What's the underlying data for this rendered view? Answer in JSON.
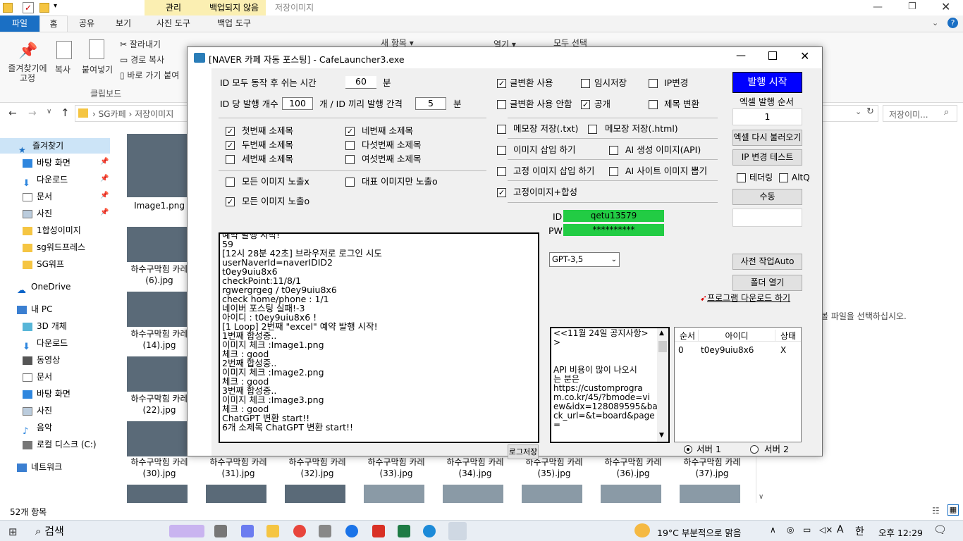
{
  "explorer": {
    "context_tabs": [
      "관리",
      "백업되지 않음",
      "저장이미지"
    ],
    "tabs": [
      "파일",
      "홈",
      "공유",
      "보기",
      "사진 도구",
      "백업 도구"
    ],
    "ribbon": {
      "pin_label": "즐겨찾기에\n고정",
      "copy_label": "복사",
      "paste_label": "붙여넣기",
      "cut_label": "잘라내기",
      "copy_path_label": "경로 복사",
      "paste_shortcut_label": "바로 가기 붙여",
      "clipboard_group": "클립보드",
      "new_item_label": "새 항목",
      "open_label": "열기",
      "select_all_label": "모두 선택"
    },
    "breadcrumb": [
      "SG카페",
      "저장이미지"
    ],
    "search_placeholder": "저장이미...",
    "nav_items": [
      "즐겨찾기",
      "바탕 화면",
      "다운로드",
      "문서",
      "사진",
      "1합성이미지",
      "sg워드프레스",
      "SG워프",
      "OneDrive",
      "내 PC",
      "3D 개체",
      "다운로드",
      "동영상",
      "문서",
      "바탕 화면",
      "사진",
      "음악",
      "로컬 디스크 (C:)",
      "네트워크"
    ],
    "files": [
      {
        "name": "Image1.png"
      },
      {
        "name": "하수구막힘 카레\n(6).jpg"
      },
      {
        "name": "하수구막힘 카레\n(14).jpg"
      },
      {
        "name": "하수구막힘 카레\n(22).jpg"
      },
      {
        "name": "하수구막힘 카레\n(30).jpg"
      },
      {
        "name": "하수구막힘 카레\n(31).jpg"
      },
      {
        "name": "하수구막힘 카레\n(32).jpg"
      },
      {
        "name": "하수구막힘 카레\n(33).jpg"
      },
      {
        "name": "하수구막힘 카레\n(34).jpg"
      },
      {
        "name": "하수구막힘 카레\n(35).jpg"
      },
      {
        "name": "하수구막힘 카레\n(36).jpg"
      },
      {
        "name": "하수구막힘 카레\n(37).jpg"
      }
    ],
    "preview_hint": "볼 파일을 선택하십시오.",
    "status": "52개 항목"
  },
  "dialog": {
    "title": "[NAVER 카페 자동 포스팅] - CafeLauncher3.exe",
    "rest_label": "ID 모두 동작 후 쉬는 시간",
    "rest_value": "60",
    "rest_unit": "분",
    "per_id_label": "ID 당 발행 개수",
    "per_id_value": "100",
    "interval_label": "개 /  ID 끼리 발행 간격",
    "interval_value": "5",
    "interval_unit": "분",
    "subtitles": [
      {
        "label": "첫번째 소제목",
        "checked": true
      },
      {
        "label": "두번째 소제목",
        "checked": true
      },
      {
        "label": "세번째 소제목",
        "checked": false
      },
      {
        "label": "네번째 소제목",
        "checked": true
      },
      {
        "label": "다섯번째 소제목",
        "checked": false
      },
      {
        "label": "여섯번째 소제목",
        "checked": false
      }
    ],
    "img_opts": [
      {
        "label": "모든 이미지 노출x",
        "checked": false
      },
      {
        "label": "대표 이미지만 노출o",
        "checked": false
      },
      {
        "label": "모든 이미지 노출o",
        "checked": true
      }
    ],
    "right_opts": [
      {
        "label": "글변환 사용",
        "checked": true
      },
      {
        "label": "임시저장",
        "checked": false
      },
      {
        "label": "IP변경",
        "checked": false
      },
      {
        "label": "글변환 사용 안함",
        "checked": false
      },
      {
        "label": "공개",
        "checked": true
      },
      {
        "label": "제목 변환",
        "checked": false
      },
      {
        "label": "메모장 저장(.txt)",
        "checked": false
      },
      {
        "label": "메모장 저장(.html)",
        "checked": false
      },
      {
        "label": "이미지 삽입 하기",
        "checked": false
      },
      {
        "label": "AI 생성 이미지(API)",
        "checked": false
      },
      {
        "label": "고정 이미지 삽입 하기",
        "checked": false
      },
      {
        "label": "AI 사이트 이미지 뽑기",
        "checked": false
      },
      {
        "label": "고정이미지+합성",
        "checked": true
      }
    ],
    "publish_btn": "발행 시작",
    "excel_order_label": "엑셀 발행 순서",
    "excel_order_value": "1",
    "reload_excel_btn": "엑셀 다시 불러오기",
    "ip_test_btn": "IP 변경 테스트",
    "tethering_label": "테더링",
    "tethering_checked": false,
    "altq_label": "AltQ",
    "altq_checked": false,
    "manual_btn": "수동",
    "manual_value": "",
    "pre_auto_btn": "사전 작업Auto",
    "folder_btn": "폴더 열기",
    "id_label": "ID",
    "id_value": "qetu13579",
    "pw_label": "PW",
    "pw_value": "**********",
    "gpt_model": "GPT-3,5",
    "download_link": "프로그램 다운로드 하기",
    "log_lines": [
      "예약 발행 시작!",
      "59",
      "[12시 28분 42초] 브라우저로 로그인 시도",
      "userNaverId=naverIDID2",
      "t0ey9uiu8x6",
      "checkPoint:11/8/1",
      "rgwergrgeg / t0ey9uiu8x6",
      "check home/phone : 1/1",
      "네이버 포스팅 실패!-3",
      "아이디 : t0ey9uiu8x6 !",
      "[1 Loop] 2번째 \"excel\" 예약 발행 시작!",
      "1번째 합성중..",
      "이미지 체크 :Image1.png",
      "체크 : good",
      "2번째 합성중..",
      "이미지 체크 :Image2.png",
      "체크 : good",
      "3번째 합성중..",
      "이미지 체크 :Image3.png",
      "체크 : good",
      "ChatGPT 변환 start!!",
      "6개 소제목 ChatGPT 변환 start!!"
    ],
    "log_save_btn": "로그저장",
    "notice_lines": [
      "<<11월 24일 공지사항>",
      ">",
      "",
      "",
      "API 비용이 많이 나오시",
      "는 분은",
      " https://customprogra",
      "m.co.kr/45/?bmode=vi",
      "ew&idx=128089595&ba",
      "ck_url=&t=board&page",
      "="
    ],
    "table_headers": [
      "순서",
      "아이디",
      "상태"
    ],
    "table_rows": [
      [
        "0",
        "t0ey9uiu8x6",
        "X"
      ]
    ],
    "server1_label": "서버 1",
    "server2_label": "서버 2",
    "server_selected": 1
  },
  "taskbar": {
    "search_label": "검색",
    "weather": "19°C  부분적으로 맑음",
    "ime": "A",
    "lang": "한",
    "clock": "오후 12:29"
  }
}
